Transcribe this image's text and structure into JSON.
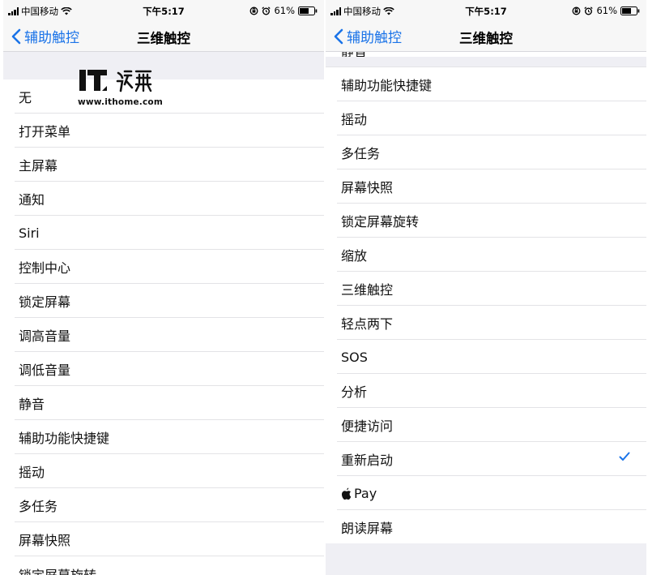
{
  "status_bar": {
    "carrier": "中国移动",
    "time": "下午5:17",
    "battery": "61%"
  },
  "nav": {
    "back_label": "辅助触控",
    "title": "三维触控"
  },
  "left_list": {
    "items": [
      "无",
      "打开菜单",
      "主屏幕",
      "通知",
      "Siri",
      "控制中心",
      "锁定屏幕",
      "调高音量",
      "调低音量",
      "静音",
      "辅助功能快捷键",
      "摇动",
      "多任务",
      "屏幕快照"
    ],
    "cut_item": "锁定屏幕旋转"
  },
  "right_list": {
    "cut_item": "静音",
    "items": [
      "辅助功能快捷键",
      "摇动",
      "多任务",
      "屏幕快照",
      "锁定屏幕旋转",
      "缩放",
      "三维触控",
      "轻点两下",
      "SOS",
      "分析",
      "便捷访问",
      "重新启动",
      "Pay",
      "朗读屏幕"
    ],
    "selected": "重新启动"
  },
  "watermark": {
    "url": "www.ithome.com"
  },
  "colors": {
    "accent": "#1a73e8",
    "background": "#efeff4",
    "bar": "#f7f7f7"
  }
}
